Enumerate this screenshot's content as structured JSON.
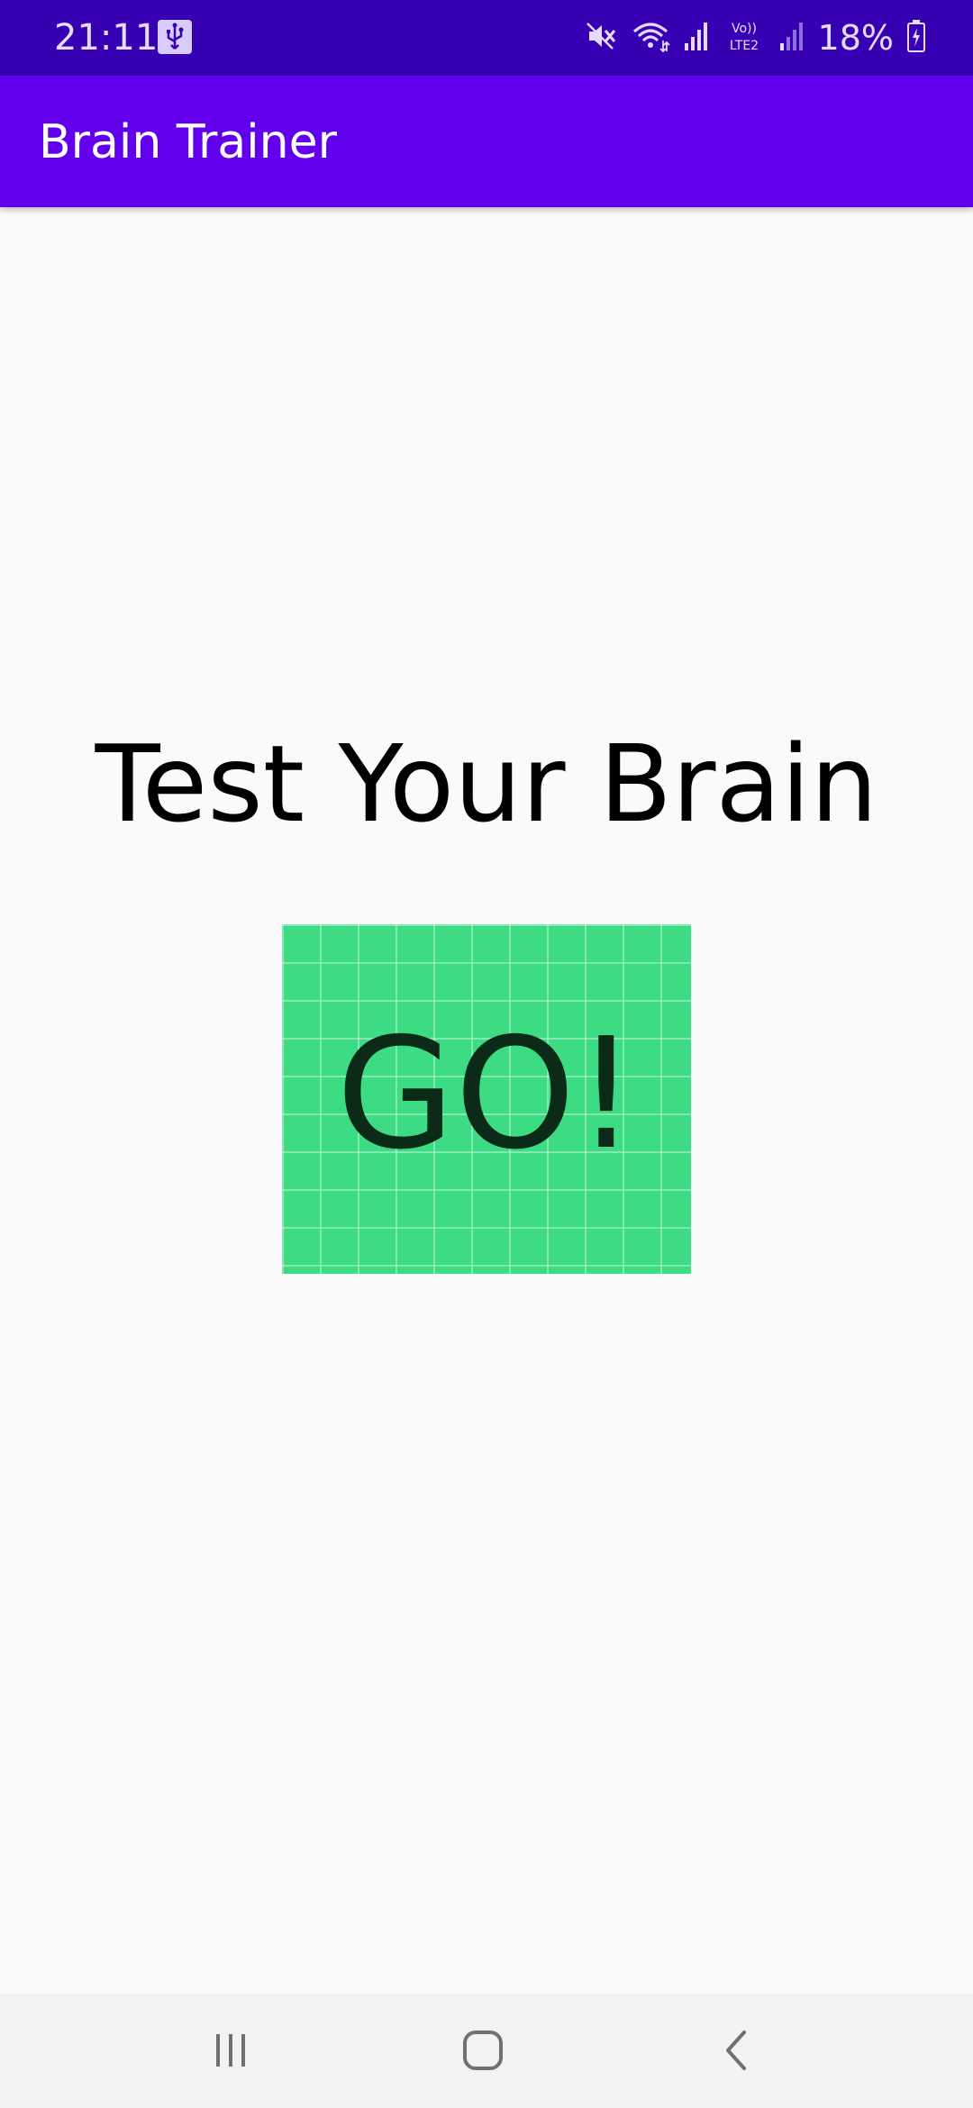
{
  "status_bar": {
    "time": "21:11",
    "battery_percent": "18%",
    "network_label_top": "Vo))",
    "network_label_bottom": "LTE2",
    "icons": [
      "usb-icon",
      "mute-icon",
      "wifi-icon",
      "signal-icon",
      "volte-icon",
      "signal-icon-2",
      "battery-icon"
    ]
  },
  "app_bar": {
    "title": "Brain Trainer"
  },
  "main": {
    "headline": "Test Your Brain",
    "go_button_label": "GO!"
  },
  "nav_bar": {
    "icons": [
      "recents-icon",
      "home-icon",
      "back-icon"
    ]
  },
  "colors": {
    "status_bar": "#3700b3",
    "app_bar": "#6200ee",
    "go_button": "#3ddc84",
    "background": "#fafafa"
  }
}
